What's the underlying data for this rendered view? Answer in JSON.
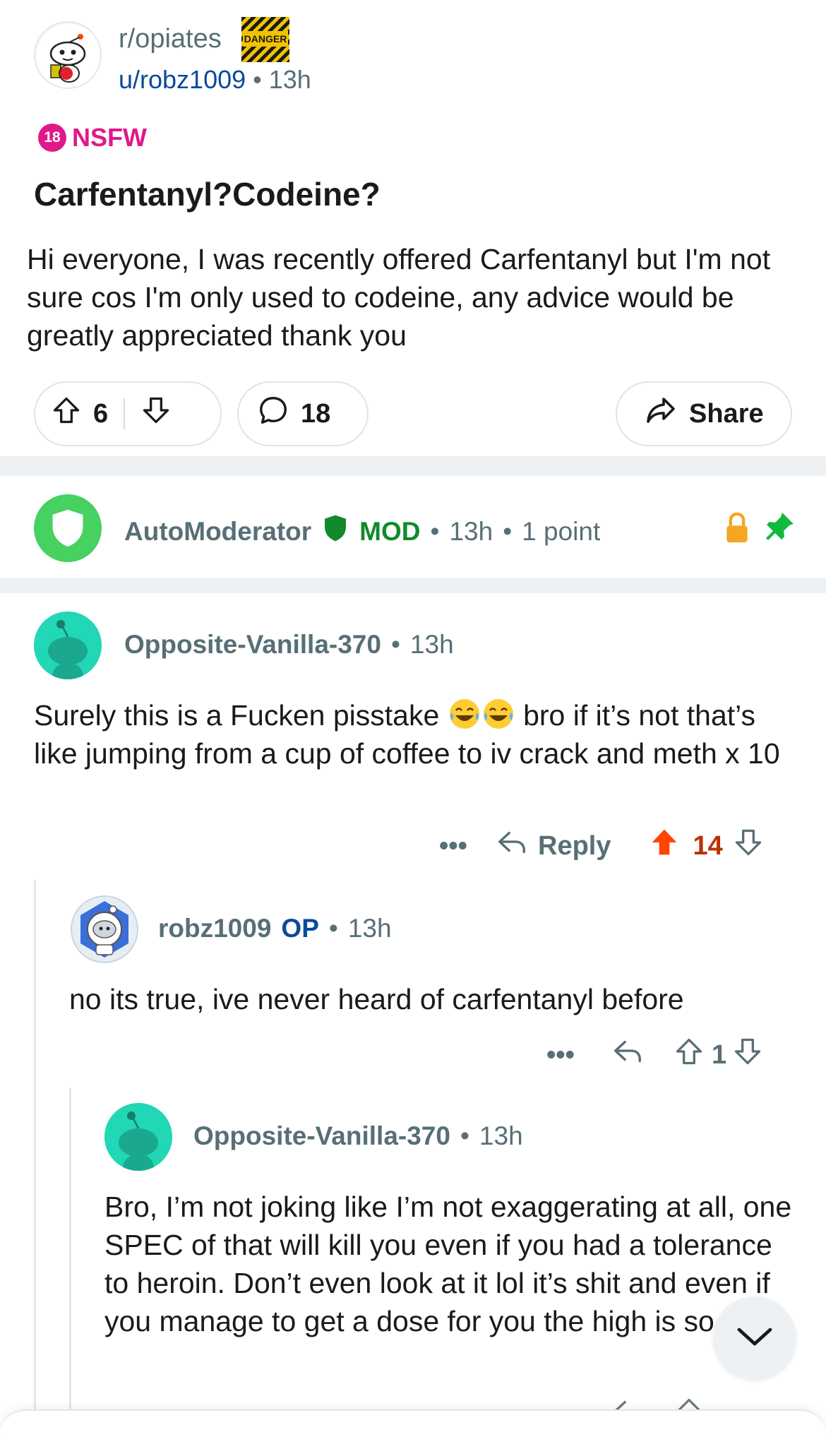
{
  "post": {
    "subreddit": "r/opiates",
    "flair_image": "DANGER",
    "author": "u/robz1009",
    "time": "13h",
    "nsfw_age": "18",
    "nsfw_label": "NSFW",
    "title": "Carfentanyl?Codeine?",
    "body": "Hi everyone, I was recently offered Carfentanyl but I'm not sure cos I'm only used to codeine, any advice would be greatly appreciated thank you",
    "votes": "6",
    "comments": "18",
    "share_label": "Share"
  },
  "automod": {
    "name": "AutoModerator",
    "mod_label": "MOD",
    "time": "13h",
    "points": "1 point"
  },
  "comments": [
    {
      "author": "Opposite-Vanilla-370",
      "time": "13h",
      "body_before": "Surely this is a Fucken pisstake",
      "emojis": [
        "joy-emoji",
        "joy-emoji"
      ],
      "body_after": "bro if it’s not that’s like jumping from a cup of coffee to iv crack and meth x 10",
      "reply_label": "Reply",
      "votes": "14"
    },
    {
      "author": "robz1009",
      "op_label": "OP",
      "time": "13h",
      "body": "no its true, ive never heard of carfentanyl before",
      "votes": "1"
    },
    {
      "author": "Opposite-Vanilla-370",
      "time": "13h",
      "body": "Bro, I’m not joking like I’m not exaggerating at all, one SPEC of that will kill you even if you had a tolerance to heroin. Don’t even look at it lol it’s shit and even if you manage to get a dose for you the high is so shit"
    }
  ],
  "colors": {
    "upvote_active": "#ff4500",
    "nsfw": "#e0198a",
    "mod_green": "#128a2c",
    "snoo_teal": "#21d7b5"
  }
}
